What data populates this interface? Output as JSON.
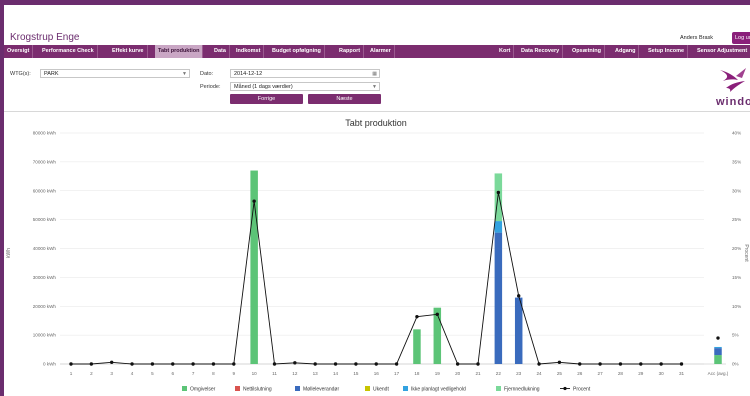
{
  "header": {
    "site_title": "Krogstrup Enge",
    "user_name": "Anders Brask",
    "logout_label": "Log ud"
  },
  "nav": {
    "left_items": [
      "Oversigt",
      "Performance Check",
      "Effekt kurve",
      "Tabt produktion",
      "Data",
      "Indkomst",
      "Budget opfølgning",
      "Rapport",
      "Alarmer"
    ],
    "right_items": [
      "Kort",
      "Data Recovery",
      "Opsætning",
      "Adgang",
      "Setup Income",
      "Sensor Adjustment"
    ],
    "active": "Tabt produktion"
  },
  "controls": {
    "wtg_label": "WTG(s):",
    "wtg_value": "PARK",
    "date_label": "Dato:",
    "date_value": "2014-12-12",
    "period_label": "Periode:",
    "period_value": "Måned (1 dags værdier)",
    "prev_label": "Forrige",
    "next_label": "Næste"
  },
  "logo": {
    "text": "windop"
  },
  "colors": {
    "brand": "#7b2d6f",
    "omgivelser": "#5cc477",
    "nettilslutning": "#d9534f",
    "mollelev": "#3a6bbd",
    "ukendt": "#c8c400",
    "ikke_planlagt": "#33a2e0",
    "fjernnedlukning": "#7bd99a",
    "procent": "#111111"
  },
  "chart_data": {
    "type": "bar",
    "title": "Tabt produktion",
    "ylabel": "kWh",
    "y2label": "Procent",
    "ylim": [
      0,
      80000
    ],
    "y2lim": [
      0,
      40
    ],
    "y_ticks": [
      "0 kWh",
      "10000 kWh",
      "20000 kWh",
      "30000 kWh",
      "40000 kWh",
      "50000 kWh",
      "60000 kWh",
      "70000 kWh",
      "80000 kWh"
    ],
    "y2_ticks": [
      "0%",
      "5%",
      "10%",
      "15%",
      "20%",
      "25%",
      "30%",
      "35%",
      "40%"
    ],
    "categories": [
      "1",
      "2",
      "3",
      "4",
      "5",
      "6",
      "7",
      "8",
      "9",
      "10",
      "11",
      "12",
      "13",
      "14",
      "15",
      "16",
      "17",
      "18",
      "19",
      "20",
      "21",
      "22",
      "23",
      "24",
      "25",
      "26",
      "27",
      "28",
      "29",
      "30",
      "31",
      "Acc (avg.)"
    ],
    "series": [
      {
        "name": "Omgivelser",
        "color_key": "omgivelser",
        "values": [
          0,
          0,
          0,
          0,
          0,
          0,
          0,
          0,
          0,
          67000,
          0,
          0,
          0,
          0,
          0,
          0,
          0,
          12000,
          19500,
          0,
          0,
          0,
          0,
          0,
          0,
          0,
          0,
          0,
          0,
          0,
          0,
          3100
        ]
      },
      {
        "name": "Nettilslutning",
        "color_key": "nettilslutning",
        "values": [
          0,
          0,
          0,
          0,
          0,
          0,
          0,
          0,
          0,
          0,
          0,
          0,
          0,
          0,
          0,
          0,
          0,
          0,
          0,
          0,
          0,
          0,
          0,
          0,
          0,
          0,
          0,
          0,
          0,
          0,
          0,
          0
        ]
      },
      {
        "name": "Mølleleverandør",
        "color_key": "mollelev",
        "values": [
          0,
          0,
          0,
          0,
          0,
          0,
          0,
          0,
          0,
          0,
          0,
          0,
          0,
          0,
          0,
          0,
          0,
          0,
          0,
          0,
          0,
          45500,
          23000,
          0,
          0,
          0,
          0,
          0,
          0,
          0,
          0,
          2400
        ]
      },
      {
        "name": "Ukendt",
        "color_key": "ukendt",
        "values": [
          0,
          0,
          0,
          0,
          0,
          0,
          0,
          0,
          0,
          0,
          0,
          0,
          0,
          0,
          0,
          0,
          0,
          0,
          0,
          0,
          0,
          0,
          0,
          0,
          0,
          0,
          0,
          0,
          0,
          0,
          0,
          0
        ]
      },
      {
        "name": "Ikke planlagt vedligehold",
        "color_key": "ikke_planlagt",
        "values": [
          0,
          0,
          0,
          0,
          0,
          0,
          0,
          0,
          0,
          0,
          0,
          0,
          0,
          0,
          0,
          0,
          0,
          0,
          0,
          0,
          0,
          4000,
          0,
          0,
          0,
          0,
          0,
          0,
          0,
          0,
          0,
          400
        ]
      },
      {
        "name": "Fjernnedlukning",
        "color_key": "fjernnedlukning",
        "values": [
          0,
          0,
          0,
          0,
          0,
          0,
          0,
          0,
          0,
          0,
          0,
          0,
          0,
          0,
          0,
          0,
          0,
          0,
          0,
          0,
          0,
          16500,
          0,
          0,
          0,
          0,
          0,
          0,
          0,
          0,
          0,
          0
        ]
      }
    ],
    "line_series": {
      "name": "Procent",
      "color_key": "procent",
      "values": [
        0,
        0,
        0.3,
        0,
        0,
        0,
        0,
        0,
        0,
        28.2,
        0,
        0.2,
        0,
        0,
        0,
        0,
        0,
        8.2,
        8.6,
        0,
        0,
        29.7,
        11.8,
        0,
        0.3,
        0,
        0,
        0,
        0,
        0,
        0,
        4.5
      ]
    },
    "legend_position": "bottom",
    "grid": "horizontal"
  }
}
